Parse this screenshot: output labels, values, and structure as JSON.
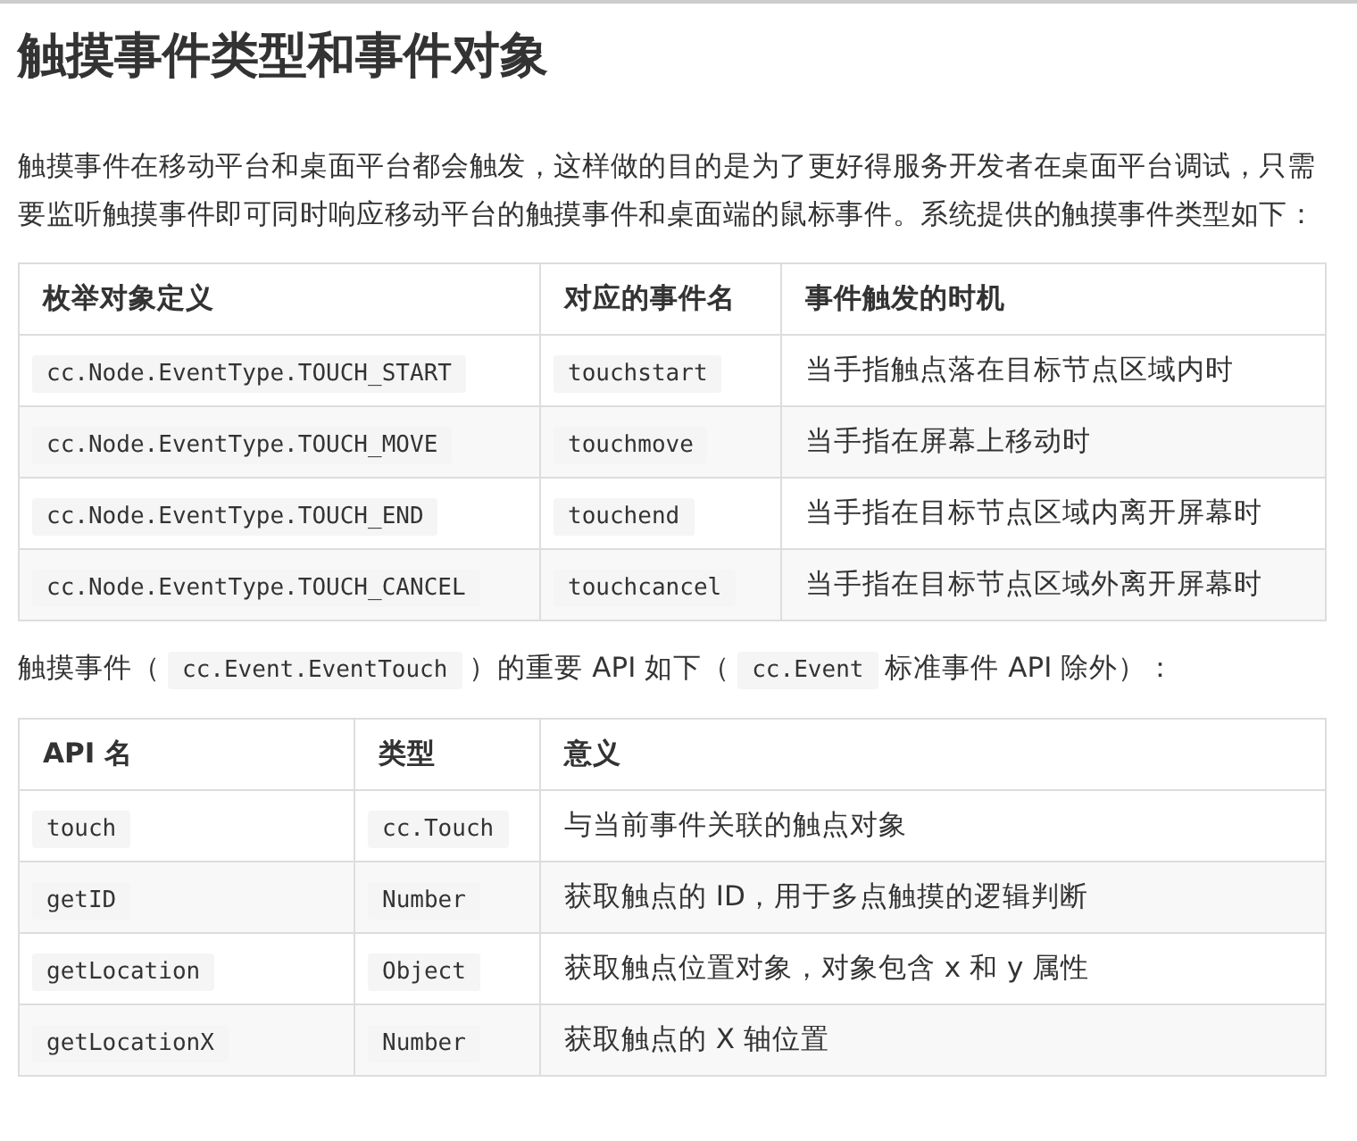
{
  "title": "触摸事件类型和事件对象",
  "intro": "触摸事件在移动平台和桌面平台都会触发，这样做的目的是为了更好得服务开发者在桌面平台调试，只需要监听触摸事件即可同时响应移动平台的触摸事件和桌面端的鼠标事件。系统提供的触摸事件类型如下：",
  "event_table": {
    "columns": [
      "枚举对象定义",
      "对应的事件名",
      "事件触发的时机"
    ],
    "rows": [
      {
        "cells": [
          {
            "kind": "code",
            "text": "cc.Node.EventType.TOUCH_START"
          },
          {
            "kind": "code",
            "text": "touchstart"
          },
          {
            "kind": "text",
            "text": "当手指触点落在目标节点区域内时"
          }
        ]
      },
      {
        "cells": [
          {
            "kind": "code",
            "text": "cc.Node.EventType.TOUCH_MOVE"
          },
          {
            "kind": "code",
            "text": "touchmove"
          },
          {
            "kind": "text",
            "text": "当手指在屏幕上移动时"
          }
        ]
      },
      {
        "cells": [
          {
            "kind": "code",
            "text": "cc.Node.EventType.TOUCH_END"
          },
          {
            "kind": "code",
            "text": "touchend"
          },
          {
            "kind": "text",
            "text": "当手指在目标节点区域内离开屏幕时"
          }
        ]
      },
      {
        "cells": [
          {
            "kind": "code",
            "text": "cc.Node.EventType.TOUCH_CANCEL"
          },
          {
            "kind": "code",
            "text": "touchcancel"
          },
          {
            "kind": "text",
            "text": "当手指在目标节点区域外离开屏幕时"
          }
        ]
      }
    ]
  },
  "api_sentence": [
    {
      "kind": "text",
      "text": "触摸事件（"
    },
    {
      "kind": "code",
      "text": "cc.Event.EventTouch"
    },
    {
      "kind": "text",
      "text": "）的重要 API 如下（"
    },
    {
      "kind": "code",
      "text": "cc.Event"
    },
    {
      "kind": "text",
      "text": "标准事件 API 除外）："
    }
  ],
  "api_table": {
    "columns": [
      "API 名",
      "类型",
      "意义"
    ],
    "rows": [
      {
        "cells": [
          {
            "kind": "code",
            "text": "touch"
          },
          {
            "kind": "code",
            "text": "cc.Touch"
          },
          {
            "kind": "text",
            "text": "与当前事件关联的触点对象"
          }
        ]
      },
      {
        "cells": [
          {
            "kind": "code",
            "text": "getID"
          },
          {
            "kind": "code",
            "text": "Number"
          },
          {
            "kind": "text",
            "text": "获取触点的 ID，用于多点触摸的逻辑判断"
          }
        ]
      },
      {
        "cells": [
          {
            "kind": "code",
            "text": "getLocation"
          },
          {
            "kind": "code",
            "text": "Object"
          },
          {
            "kind": "text",
            "text": "获取触点位置对象，对象包含 x 和 y 属性"
          }
        ]
      },
      {
        "cells": [
          {
            "kind": "code",
            "text": "getLocationX"
          },
          {
            "kind": "code",
            "text": "Number"
          },
          {
            "kind": "text",
            "text": "获取触点的 X 轴位置"
          }
        ]
      }
    ]
  }
}
